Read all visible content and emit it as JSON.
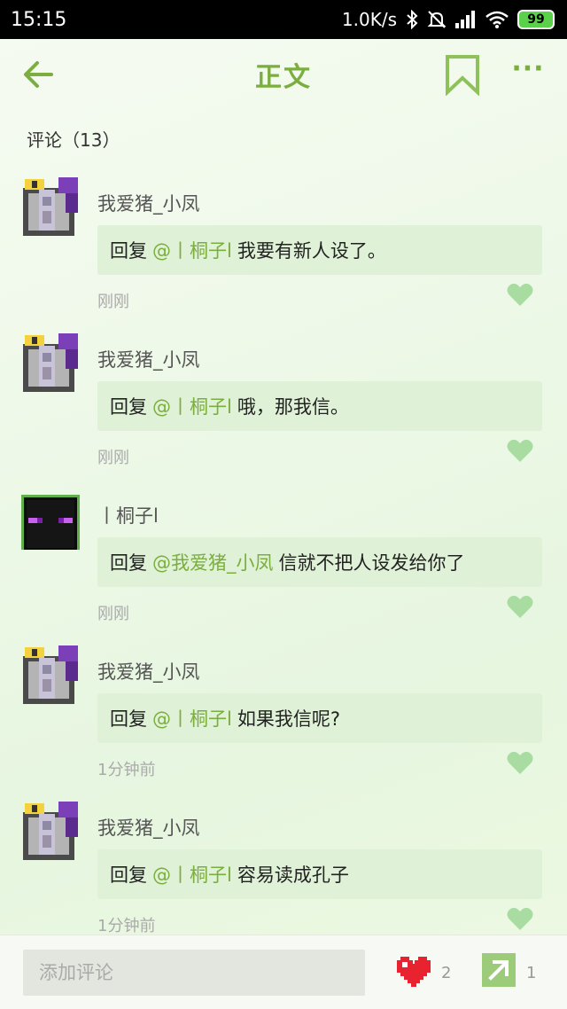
{
  "status_bar": {
    "time": "15:15",
    "network_speed": "1.0K/s",
    "battery": "99",
    "icons": [
      "bluetooth-icon",
      "mute-icon",
      "signal-icon",
      "wifi-icon",
      "battery-icon"
    ]
  },
  "header": {
    "title": "正文",
    "more": "···",
    "accent_color": "#7bae3e"
  },
  "comments_section": {
    "header": "评论（13）",
    "comments": [
      {
        "author": "我爱猪_小凤",
        "reply_prefix": "回复",
        "mention": "@丨桐子l",
        "text": "我要有新人设了。",
        "time": "刚刚",
        "avatar": "pixel-knight"
      },
      {
        "author": "我爱猪_小凤",
        "reply_prefix": "回复",
        "mention": "@丨桐子l",
        "text": "哦，那我信。",
        "time": "刚刚",
        "avatar": "pixel-knight"
      },
      {
        "author": "丨桐子l",
        "reply_prefix": "回复",
        "mention": "@我爱猪_小凤",
        "text": "信就不把人设发给你了",
        "time": "刚刚",
        "avatar": "pixel-enderman"
      },
      {
        "author": "我爱猪_小凤",
        "reply_prefix": "回复",
        "mention": "@丨桐子l",
        "text": "如果我信呢?",
        "time": "1分钟前",
        "avatar": "pixel-knight"
      },
      {
        "author": "我爱猪_小凤",
        "reply_prefix": "回复",
        "mention": "@丨桐子l",
        "text": "容易读成孔子",
        "time": "1分钟前",
        "avatar": "pixel-knight"
      }
    ]
  },
  "bottom_bar": {
    "comment_placeholder": "添加评论",
    "like_count": "2",
    "share_count": "1",
    "like_color": "#e8232f",
    "share_color": "#9ccc7a"
  }
}
